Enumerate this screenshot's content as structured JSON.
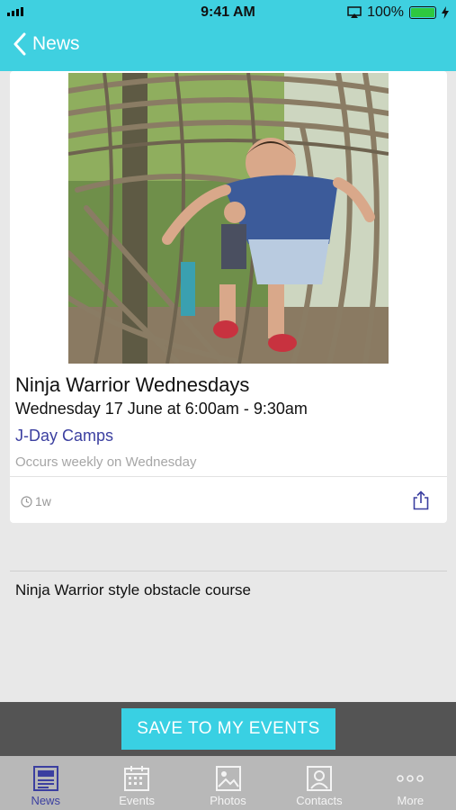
{
  "status_bar": {
    "time": "9:41 AM",
    "battery_percent": "100%",
    "battery_level": 1.0,
    "battery_color": "#2ec840"
  },
  "nav": {
    "back_label": "News"
  },
  "event": {
    "title": "Ninja Warrior Wednesdays",
    "datetime": "Wednesday 17 June at 6:00am - 9:30am",
    "organization": "J-Day Camps",
    "recurrence": "Occurs weekly on Wednesday",
    "age": "1w",
    "description": "Ninja Warrior style obstacle course"
  },
  "actions": {
    "save_label": "SAVE TO MY EVENTS"
  },
  "tabs": [
    {
      "label": "News",
      "icon": "newspaper-icon",
      "active": true
    },
    {
      "label": "Events",
      "icon": "calendar-icon",
      "active": false
    },
    {
      "label": "Photos",
      "icon": "photo-icon",
      "active": false
    },
    {
      "label": "Contacts",
      "icon": "contact-card-icon",
      "active": false
    },
    {
      "label": "More",
      "icon": "ellipsis-icon",
      "active": false
    }
  ],
  "colors": {
    "accent": "#3fd0e0",
    "active_tab": "#3b3fa0",
    "link": "#3b3fa0"
  }
}
